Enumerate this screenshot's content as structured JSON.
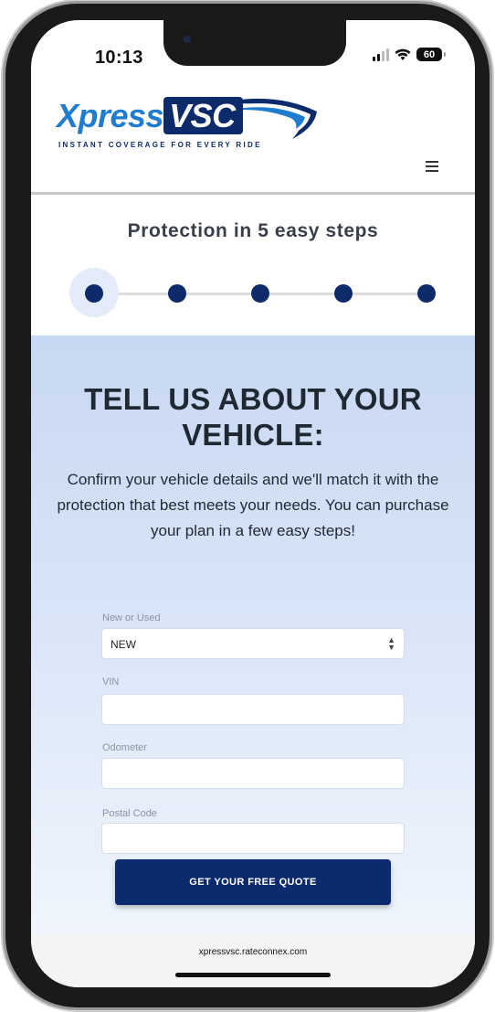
{
  "status_bar": {
    "time": "10:13",
    "battery": "60"
  },
  "header": {
    "logo_part1": "Xpress",
    "logo_part2": "VSC",
    "tagline": "INSTANT COVERAGE FOR EVERY RIDE",
    "menu_icon": "hamburger-menu-icon"
  },
  "steps": {
    "title": "Protection in 5 easy steps",
    "total": 5,
    "current": 1
  },
  "form": {
    "heading": "TELL US ABOUT YOUR VEHICLE:",
    "description": "Confirm your vehicle details and we'll match it with the protection that best meets your needs. You can purchase your plan in a few easy steps!",
    "fields": {
      "condition": {
        "label": "New or Used",
        "value": "NEW"
      },
      "vin": {
        "label": "VIN",
        "value": ""
      },
      "odometer": {
        "label": "Odometer",
        "value": ""
      },
      "postal": {
        "label": "Postal Code",
        "value": ""
      }
    },
    "submit_label": "GET YOUR FREE QUOTE"
  },
  "browser": {
    "url": "xpressvsc.rateconnex.com"
  },
  "colors": {
    "brand_navy": "#0d2a6b",
    "brand_blue": "#1f7ccf",
    "form_bg": "#c8d8f2"
  }
}
